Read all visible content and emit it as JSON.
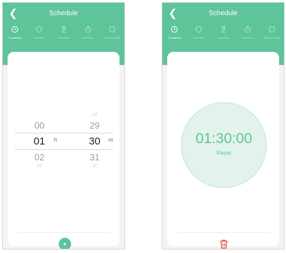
{
  "screen_left": {
    "title": "Schedule",
    "tabs": [
      {
        "label": "Countdown",
        "icon": "clock-icon",
        "active": true
      },
      {
        "label": "Schedule",
        "icon": "shield-icon",
        "active": false
      },
      {
        "label": "Circulate",
        "icon": "hourglass-icon",
        "active": false
      },
      {
        "label": "Random",
        "icon": "timer-icon",
        "active": false
      },
      {
        "label": "Astronomical",
        "icon": "badge-icon",
        "active": false
      }
    ],
    "picker": {
      "hours": {
        "above_far": "",
        "above": "00",
        "selected": "01",
        "below": "02",
        "below_far": "03",
        "unit": "h"
      },
      "minutes": {
        "above_far": "28",
        "above": "29",
        "selected": "30",
        "below": "31",
        "below_far": "32",
        "unit": "m"
      }
    },
    "accent_color": "#5ec49a"
  },
  "screen_right": {
    "title": "Schedule",
    "tabs": [
      {
        "label": "Countdown",
        "icon": "clock-icon",
        "active": true
      },
      {
        "label": "Schedule",
        "icon": "shield-icon",
        "active": false
      },
      {
        "label": "Circulate",
        "icon": "hourglass-icon",
        "active": false
      },
      {
        "label": "Random",
        "icon": "timer-icon",
        "active": false
      },
      {
        "label": "Astronomical",
        "icon": "badge-icon",
        "active": false
      }
    ],
    "countdown": {
      "time": "01:30:00",
      "reset_label": "Reset"
    },
    "delete_color": "#e05555"
  }
}
